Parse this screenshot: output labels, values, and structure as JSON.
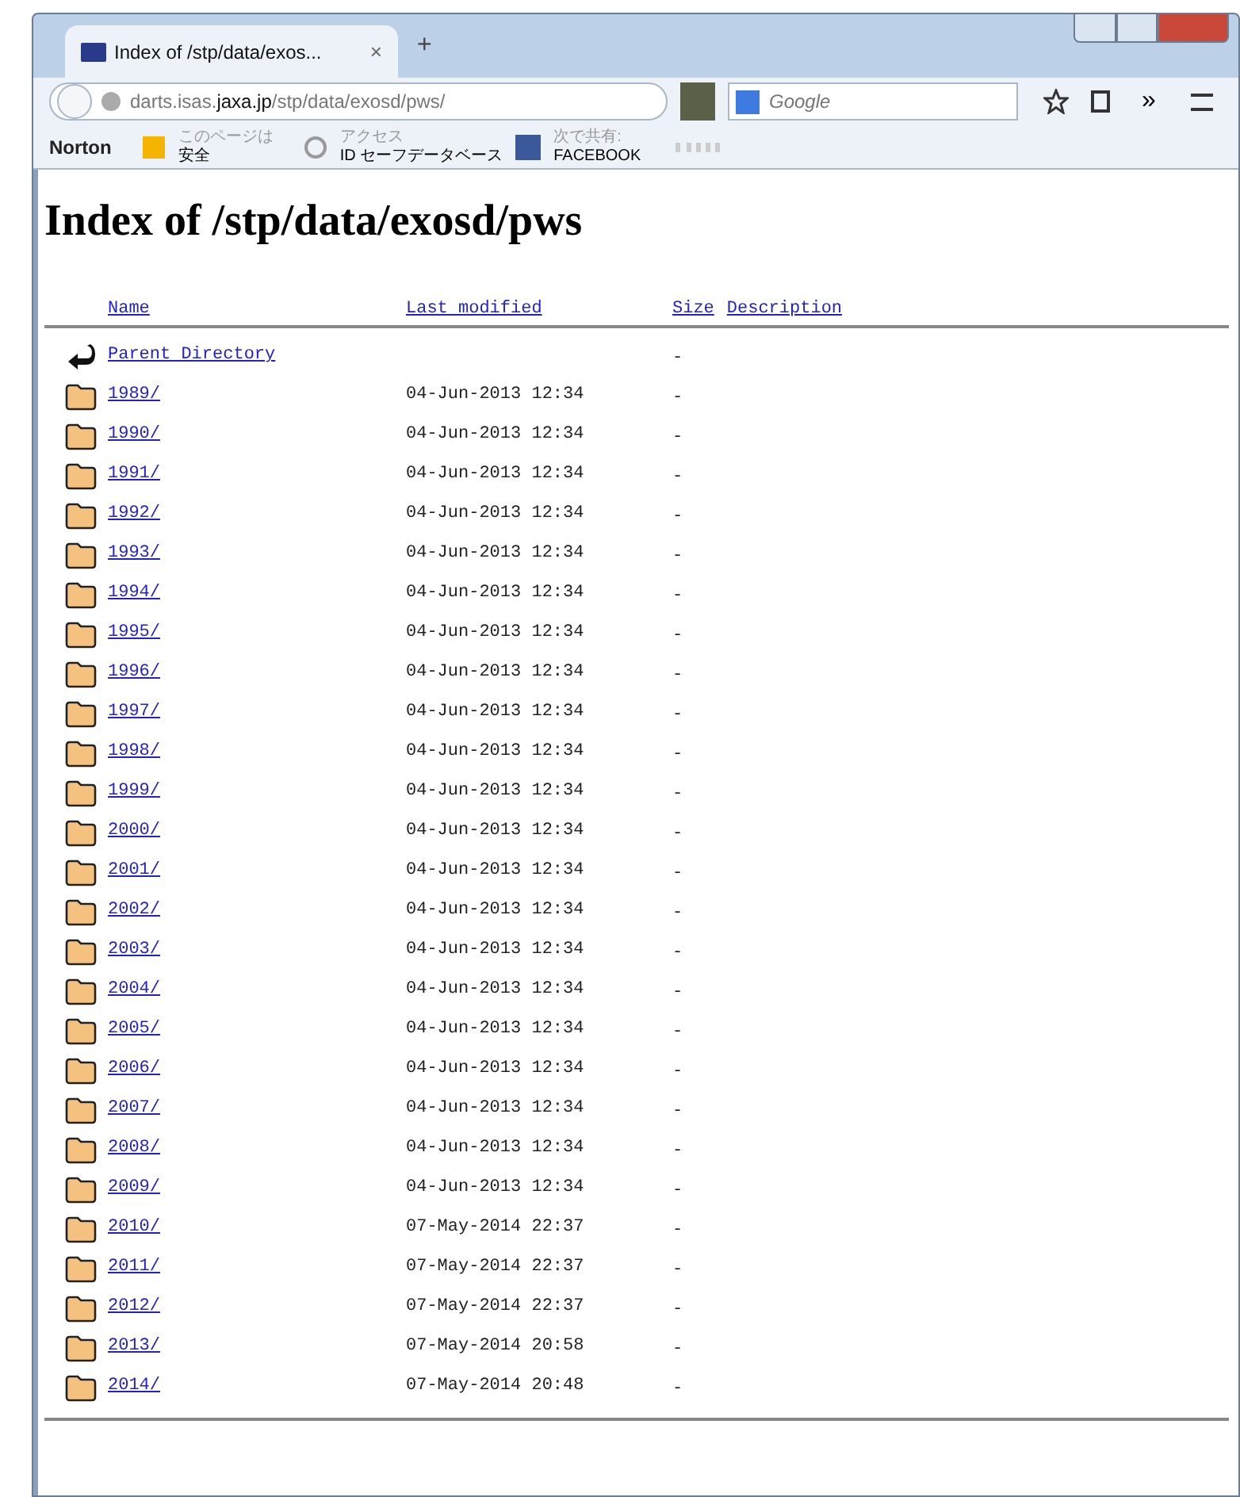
{
  "tab": {
    "title": "Index of /stp/data/exos...",
    "close": "×",
    "new_tab": "+"
  },
  "nav": {
    "url_host_pre": "darts.isas.",
    "url_host_main": "jaxa.jp",
    "url_path": "/stp/data/exosd/pws/",
    "search_placeholder": "Google",
    "more": "»"
  },
  "norton": {
    "logo": "Norton",
    "safe_top": "このページは",
    "safe_bottom": "安全",
    "access_top": "アクセス",
    "access_bottom": "ID セーフデータベース",
    "share_top": "次で共有:",
    "share_bottom": "FACEBOOK"
  },
  "page": {
    "heading": "Index of /stp/data/exosd/pws",
    "columns": [
      "Name",
      "Last modified",
      "Size",
      "Description"
    ],
    "rows": [
      {
        "kind": "parent",
        "name": "Parent Directory",
        "modified": "",
        "size": "-"
      },
      {
        "kind": "folder",
        "name": "1989/",
        "modified": "04-Jun-2013 12:34",
        "size": "-"
      },
      {
        "kind": "folder",
        "name": "1990/",
        "modified": "04-Jun-2013 12:34",
        "size": "-"
      },
      {
        "kind": "folder",
        "name": "1991/",
        "modified": "04-Jun-2013 12:34",
        "size": "-"
      },
      {
        "kind": "folder",
        "name": "1992/",
        "modified": "04-Jun-2013 12:34",
        "size": "-"
      },
      {
        "kind": "folder",
        "name": "1993/",
        "modified": "04-Jun-2013 12:34",
        "size": "-"
      },
      {
        "kind": "folder",
        "name": "1994/",
        "modified": "04-Jun-2013 12:34",
        "size": "-"
      },
      {
        "kind": "folder",
        "name": "1995/",
        "modified": "04-Jun-2013 12:34",
        "size": "-"
      },
      {
        "kind": "folder",
        "name": "1996/",
        "modified": "04-Jun-2013 12:34",
        "size": "-"
      },
      {
        "kind": "folder",
        "name": "1997/",
        "modified": "04-Jun-2013 12:34",
        "size": "-"
      },
      {
        "kind": "folder",
        "name": "1998/",
        "modified": "04-Jun-2013 12:34",
        "size": "-"
      },
      {
        "kind": "folder",
        "name": "1999/",
        "modified": "04-Jun-2013 12:34",
        "size": "-"
      },
      {
        "kind": "folder",
        "name": "2000/",
        "modified": "04-Jun-2013 12:34",
        "size": "-"
      },
      {
        "kind": "folder",
        "name": "2001/",
        "modified": "04-Jun-2013 12:34",
        "size": "-"
      },
      {
        "kind": "folder",
        "name": "2002/",
        "modified": "04-Jun-2013 12:34",
        "size": "-"
      },
      {
        "kind": "folder",
        "name": "2003/",
        "modified": "04-Jun-2013 12:34",
        "size": "-"
      },
      {
        "kind": "folder",
        "name": "2004/",
        "modified": "04-Jun-2013 12:34",
        "size": "-"
      },
      {
        "kind": "folder",
        "name": "2005/",
        "modified": "04-Jun-2013 12:34",
        "size": "-"
      },
      {
        "kind": "folder",
        "name": "2006/",
        "modified": "04-Jun-2013 12:34",
        "size": "-"
      },
      {
        "kind": "folder",
        "name": "2007/",
        "modified": "04-Jun-2013 12:34",
        "size": "-"
      },
      {
        "kind": "folder",
        "name": "2008/",
        "modified": "04-Jun-2013 12:34",
        "size": "-"
      },
      {
        "kind": "folder",
        "name": "2009/",
        "modified": "04-Jun-2013 12:34",
        "size": "-"
      },
      {
        "kind": "folder",
        "name": "2010/",
        "modified": "07-May-2014 22:37",
        "size": "-"
      },
      {
        "kind": "folder",
        "name": "2011/",
        "modified": "07-May-2014 22:37",
        "size": "-"
      },
      {
        "kind": "folder",
        "name": "2012/",
        "modified": "07-May-2014 22:37",
        "size": "-"
      },
      {
        "kind": "folder",
        "name": "2013/",
        "modified": "07-May-2014 20:58",
        "size": "-"
      },
      {
        "kind": "folder",
        "name": "2014/",
        "modified": "07-May-2014 20:48",
        "size": "-"
      }
    ]
  }
}
